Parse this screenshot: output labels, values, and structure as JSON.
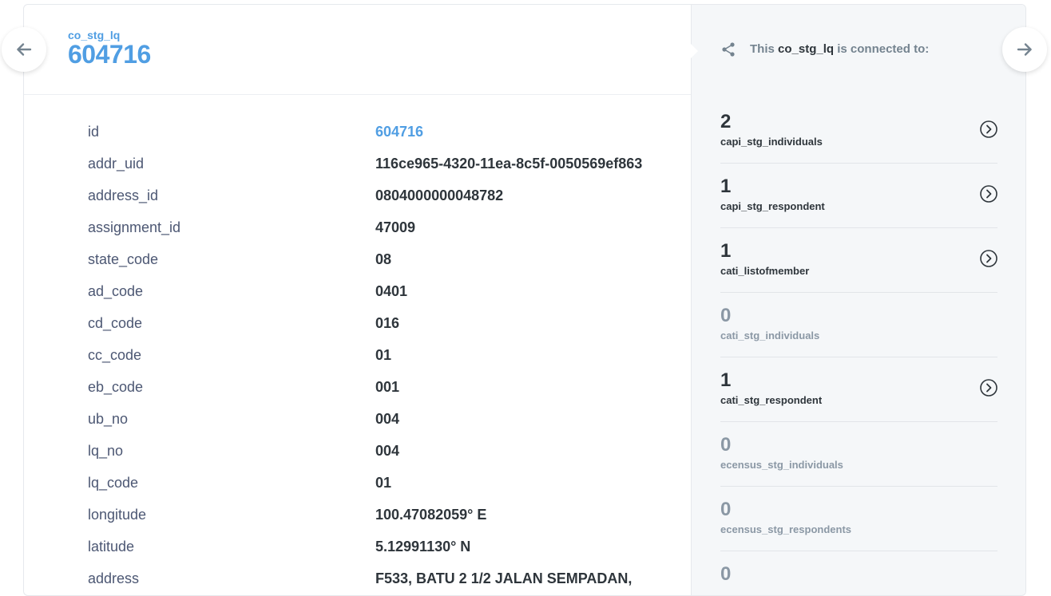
{
  "header": {
    "table_name": "co_stg_lq",
    "record_id": "604716"
  },
  "relationships": {
    "title_prefix": "This",
    "title_table": "co_stg_lq",
    "title_suffix": "is connected to:",
    "items": [
      {
        "count": "2",
        "name": "capi_stg_individuals"
      },
      {
        "count": "1",
        "name": "capi_stg_respondent"
      },
      {
        "count": "1",
        "name": "cati_listofmember"
      },
      {
        "count": "0",
        "name": "cati_stg_individuals"
      },
      {
        "count": "1",
        "name": "cati_stg_respondent"
      },
      {
        "count": "0",
        "name": "ecensus_stg_individuals"
      },
      {
        "count": "0",
        "name": "ecensus_stg_respondents"
      },
      {
        "count": "0",
        "name": ""
      }
    ]
  },
  "fields": [
    {
      "label": "id",
      "value": "604716"
    },
    {
      "label": "addr_uid",
      "value": "116ce965-4320-11ea-8c5f-0050569ef863"
    },
    {
      "label": "address_id",
      "value": "0804000000048782"
    },
    {
      "label": "assignment_id",
      "value": "47009"
    },
    {
      "label": "state_code",
      "value": "08"
    },
    {
      "label": "ad_code",
      "value": "0401"
    },
    {
      "label": "cd_code",
      "value": "016"
    },
    {
      "label": "cc_code",
      "value": "01"
    },
    {
      "label": "eb_code",
      "value": "001"
    },
    {
      "label": "ub_no",
      "value": "004"
    },
    {
      "label": "lq_no",
      "value": "004"
    },
    {
      "label": "lq_code",
      "value": "01"
    },
    {
      "label": "longitude",
      "value": "100.47082059° E"
    },
    {
      "label": "latitude",
      "value": "5.12991130° N"
    },
    {
      "label": "address",
      "value": "F533, BATU 2 1/2 JALAN SEMPADAN,"
    }
  ],
  "icons": {
    "prev": "arrow-left-icon",
    "next": "arrow-right-icon",
    "share": "connections-icon",
    "row_arrow": "chevron-circle-right-icon"
  },
  "colors": {
    "brand": "#509ee3",
    "text": "#2e353b",
    "muted": "#8b98a5"
  }
}
